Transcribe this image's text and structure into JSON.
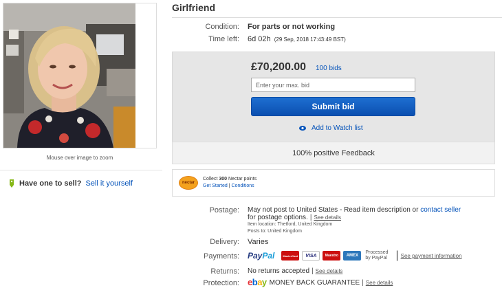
{
  "item": {
    "title": "Girlfriend",
    "image_caption": "Mouse over image to zoom"
  },
  "details": {
    "condition_label": "Condition:",
    "condition_value": "For parts or not working",
    "time_left_label": "Time left:",
    "time_left_value": "6d 02h",
    "time_left_end": "(29 Sep, 2018  17:43:49 BST)"
  },
  "bid": {
    "price": "£70,200.00",
    "bids_link": "100 bids",
    "input_placeholder": "Enter your max. bid",
    "submit_label": "Submit bid",
    "watch_label": "Add to Watch list",
    "feedback": "100% positive Feedback"
  },
  "nectar": {
    "logo_text": "nectar",
    "line1_prefix": "Collect",
    "points": "300",
    "line1_suffix": "Nectar points",
    "get_started": "Get Started",
    "separator": "|",
    "conditions": "Conditions"
  },
  "sell": {
    "question": "Have one to sell?",
    "link": "Sell it yourself"
  },
  "postage": {
    "label": "Postage:",
    "text_before_link": "May not post to United States - Read item description or",
    "link": "contact seller",
    "text_after_link": "for postage options.",
    "see_details": "See details",
    "item_location": "Item location:  Thetford, United Kingdom",
    "posts_to": "Posts to:  United Kingdom"
  },
  "delivery": {
    "label": "Delivery:",
    "value": "Varies"
  },
  "payments": {
    "label": "Payments:",
    "paypal_part1": "Pay",
    "paypal_part2": "Pal",
    "cards": [
      "MasterCard",
      "VISA",
      "Maestro",
      "AMEX"
    ],
    "processed_line1": "Processed",
    "processed_line2": "by PayPal",
    "see_payment": "See payment information"
  },
  "returns": {
    "label": "Returns:",
    "value": "No returns accepted",
    "see_details": "See details"
  },
  "protection": {
    "label": "Protection:",
    "ebay_e": "e",
    "ebay_b": "b",
    "ebay_a": "a",
    "ebay_y": "y",
    "guarantee": "MONEY BACK GUARANTEE",
    "see_details": "See details"
  },
  "colors": {
    "link_blue": "#0654ba",
    "button_blue": "#0b5fc4",
    "bid_panel": "#e6e6e6"
  },
  "icons": [
    "tag-icon",
    "eye-icon",
    "nectar-logo",
    "paypal-logo",
    "mastercard-icon",
    "visa-icon",
    "maestro-icon",
    "amex-icon",
    "ebay-logo"
  ]
}
